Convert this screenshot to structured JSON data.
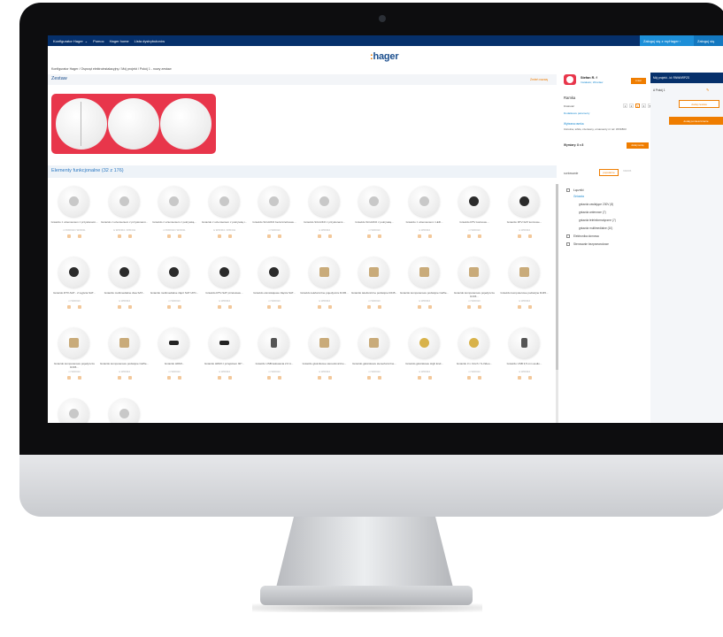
{
  "nav": {
    "items": [
      "Konfigurator Hager",
      "Pomoc",
      "Hager home",
      "Lista dystrybutorów"
    ],
    "login": "Zaloguj się z myHager",
    "login2": "Zaloguj się"
  },
  "logo": {
    "prefix": ":",
    "text": "hager"
  },
  "breadcrumb": "Konfigurator Hager / Osprzęt elektroinstalacyjny / Mój projekt / Pokój 1 - nowy zestaw",
  "zestaw": {
    "title": "Zestaw",
    "edit_link": "Zmień nazwę"
  },
  "elements": {
    "title": "Elementy funkcjonalne (32 z 176)",
    "sort_label": "sortowanie",
    "sort_active": "popularne",
    "sort_other": "nazwa"
  },
  "products": [
    {
      "name": "Gniazdo z uziemieniem z przysłonami...",
      "code": "nr WXF010 / WXF011",
      "kind": "socket"
    },
    {
      "name": "Gniazdo z uziemieniem z przysłonami...",
      "code": "nr WXF010 / WXF011",
      "kind": "socket"
    },
    {
      "name": "Gniazdo z uziemieniem z pokrywką...",
      "code": "nr WXF010 / WXF011",
      "kind": "cover"
    },
    {
      "name": "Gniazdo z uziemieniem z pokrywką i...",
      "code": "nr WXF010 / WXF011",
      "kind": "cover"
    },
    {
      "name": "Gniazdo SCHUKO bezszczelinowe...",
      "code": "nr WXF010",
      "kind": "socket"
    },
    {
      "name": "Gniazdo SCHUKO z przysłonami...",
      "code": "nr WXF010",
      "kind": "socket"
    },
    {
      "name": "Gniazdo SCHUKO z pokrywką...",
      "code": "nr WXF010",
      "kind": "cover"
    },
    {
      "name": "Gniazdo z uziemieniem i LED...",
      "code": "nr WXF010",
      "kind": "socket"
    },
    {
      "name": "Gniazdo RTV końcowe...",
      "code": "nr WXF010",
      "kind": "rtv"
    },
    {
      "name": "Gniazdo RTV-SAT końcowe...",
      "code": "nr WXF010",
      "kind": "rtv"
    },
    {
      "name": "Gniazdo RTV-SAT - 2 wyjścia SAT...",
      "code": "nr WXF010",
      "kind": "rtv"
    },
    {
      "name": "Gniazdo multimedialne dwa SAT...",
      "code": "nr WXF010",
      "kind": "rtv"
    },
    {
      "name": "Gniazdo multimedialne złącz SAT UPC...",
      "code": "nr WXF010",
      "kind": "rtv"
    },
    {
      "name": "Gniazdo RTV-SAT przelotowe...",
      "code": "nr WXF010",
      "kind": "rtv"
    },
    {
      "name": "Gniazdo ośmiokątowe złącza SAT...",
      "code": "nr WXF010",
      "kind": "rtv"
    },
    {
      "name": "Gniazdo telefoniczne pojedyncze RJ45...",
      "code": "nr WXF010",
      "kind": "rj"
    },
    {
      "name": "Gniazdo telefoniczne podwójne RJ45...",
      "code": "nr WXF010",
      "kind": "rj"
    },
    {
      "name": "Gniazdo komputerowe podwójne Cat5e...",
      "code": "nr WXF010",
      "kind": "rj"
    },
    {
      "name": "Gniazdo komputerowe pojedyncze RJ45...",
      "code": "nr WXF010",
      "kind": "rj"
    },
    {
      "name": "Gniazdo komputerowe podwójne RJ45...",
      "code": "nr WXF010",
      "kind": "rj"
    },
    {
      "name": "Gniazdo komputerowe pojedyncze RJ45...",
      "code": "nr WXF010",
      "kind": "rj"
    },
    {
      "name": "Gniazdo komputerowe podwójne Cat5e...",
      "code": "nr WXF010",
      "kind": "rj"
    },
    {
      "name": "Gniazdo HDMI...",
      "code": "nr WXF010",
      "kind": "hdmi"
    },
    {
      "name": "Gniazdo HDMI z przejściem 90°...",
      "code": "nr WXF010",
      "kind": "hdmi"
    },
    {
      "name": "Gniazdo USB ładowania 2.0 A...",
      "code": "nr WXF010",
      "kind": "usb"
    },
    {
      "name": "Gniazdo głośnikowe stereofoniczne...",
      "code": "nr WXF010",
      "kind": "spk"
    },
    {
      "name": "Gniazdo głośnikowe stereofoniczne...",
      "code": "nr WXF010",
      "kind": "spk"
    },
    {
      "name": "Gniazdo głośnikowe High End...",
      "code": "nr WXF010",
      "kind": "gold"
    },
    {
      "name": "Gniazdo 3 x Cinch / S-Video...",
      "code": "nr WXF010",
      "kind": "cinch"
    },
    {
      "name": "Gniazdo USB 3,5 mm audio...",
      "code": "nr WXF010",
      "kind": "usb"
    },
    {
      "name": "",
      "code": "",
      "kind": "socket"
    },
    {
      "name": "",
      "code": "",
      "kind": "socket"
    }
  ],
  "filters": {
    "items": [
      "Łączniki",
      "Gniazda",
      "gniazda zasilające 230V (8)",
      "gniazda antenowe (7)",
      "gniazda teleinformatyczne (7)",
      "gniazda multimedialne (10)",
      "Elektronika domowa",
      "Sterowanie bezprzewodowe"
    ]
  },
  "user": {
    "name": "Stefan R. f",
    "sub": "Instalator, Wrocław",
    "button": "zmień"
  },
  "ramka": {
    "title": "Ramka",
    "krotnosc_label": "Krotność",
    "numbers": [
      "1",
      "2",
      "3",
      "4",
      "5"
    ],
    "selected": "3",
    "dodatkowe": "Dodatkowe parametry",
    "wybrana": "Wybrana ramka",
    "desc": "3-krotna, szkło, czerwony, ornamenty\nnr ref. WXF803",
    "wymiary": "Wymiary: 8 x 8",
    "dodaj": "dodaj ramkę"
  },
  "right": {
    "header": "Mój projekt - id: RNWNRPZS",
    "point": "A  Pokój 1",
    "btn1": "dodaj zestaw",
    "btn2": "dodaj pomieszczenie"
  }
}
